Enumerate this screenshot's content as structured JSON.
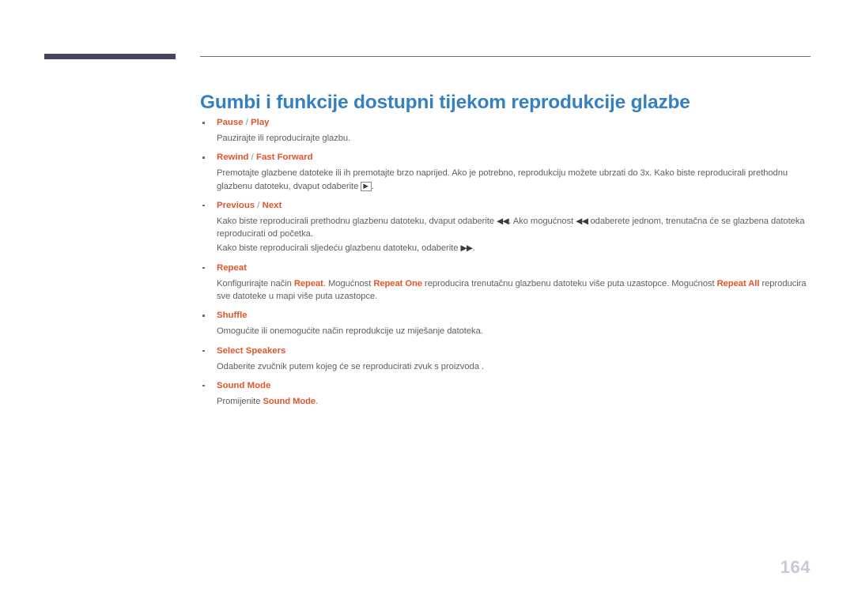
{
  "document": {
    "title": "Gumbi i funkcije dostupni tijekom reprodukcije glazbe",
    "page_number": "164",
    "title_color": "#3580c0",
    "heading_color": "#e2552a",
    "body_color": "#5f5f5f",
    "rule_color": "#454560"
  },
  "sections": [
    {
      "heading_parts": {
        "first": "Pause",
        "separator": " / ",
        "second": "Play"
      },
      "paragraphs": [
        {
          "text": "Pauzirajte ili reproducirajte glazbu."
        }
      ]
    },
    {
      "heading_parts": {
        "first": "Rewind",
        "separator": " / ",
        "second": "Fast Forward"
      },
      "paragraphs": [
        {
          "text": "Premotajte glazbene datoteke ili ih premotajte brzo naprijed. Ako je potrebno, reprodukciju možete ubrzati do 3x. Kako biste reproducirali prethodnu glazbenu datoteku, dvaput odaberite ",
          "trailing": "."
        }
      ]
    },
    {
      "heading_parts": {
        "first": "Previous",
        "separator": " / ",
        "second": "Next"
      },
      "paragraphs": [
        {
          "lead": "Kako biste reproducirali prethodnu glazbenu datoteku, dvaput odaberite ",
          "mid": ". Ako mogućnost ",
          "tail": " odaberete jednom, trenutačna će se glazbena datoteka reproducirati od početka."
        },
        {
          "lead": "Kako biste reproducirali sljedeću glazbenu datoteku, odaberite ",
          "tail": "."
        }
      ]
    },
    {
      "heading_parts": {
        "first": "Repeat",
        "separator": "",
        "second": ""
      },
      "paragraphs": [
        {
          "p1": "Konfigurirajte način ",
          "b1": "Repeat",
          "p2": ". Mogućnost ",
          "b2": "Repeat One",
          "p3": " reproducira trenutačnu glazbenu datoteku više puta uzastopce. Mogućnost ",
          "b3": "Repeat All",
          "p4": " reproducira sve datoteke u mapi više puta uzastopce."
        }
      ]
    },
    {
      "heading_parts": {
        "first": "Shuffle",
        "separator": "",
        "second": ""
      },
      "paragraphs": [
        {
          "text": "Omogućite ili onemogućite način reprodukcije uz miješanje datoteka."
        }
      ]
    },
    {
      "heading_parts": {
        "first": "Select Speakers",
        "separator": "",
        "second": ""
      },
      "paragraphs": [
        {
          "text": "Odaberite zvučnik putem kojeg će se reproducirati zvuk s proizvoda ."
        }
      ]
    },
    {
      "heading_parts": {
        "first": "Sound Mode",
        "separator": "",
        "second": ""
      },
      "paragraphs": [
        {
          "p1": "Promijenite ",
          "b1": "Sound Mode",
          "p2": "."
        }
      ]
    }
  ],
  "glyphs": {
    "play_boxed": "▶",
    "skip_backward": "◀◀",
    "skip_forward": "▶▶"
  }
}
